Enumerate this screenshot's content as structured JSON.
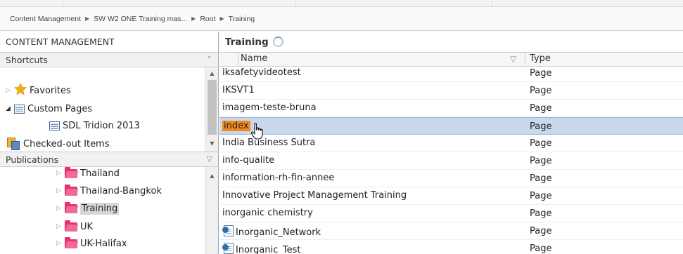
{
  "breadcrumb": {
    "items": [
      "Content Management",
      "SW W2 ONE Training mas...",
      "Root",
      "Training"
    ]
  },
  "left_panel": {
    "title": "CONTENT MANAGEMENT",
    "shortcuts": {
      "header": "Shortcuts",
      "items": [
        {
          "label": "Favorites",
          "icon": "star-icon"
        },
        {
          "label": "Custom Pages",
          "icon": "custom-page-icon"
        },
        {
          "label": "SDL Tridion 2013",
          "icon": "custom-page-icon"
        },
        {
          "label": "Checked-out Items",
          "icon": "checked-out-icon"
        }
      ]
    },
    "publications": {
      "header": "Publications",
      "items": [
        {
          "label": "Thailand",
          "selected": false
        },
        {
          "label": "Thailand-Bangkok",
          "selected": false
        },
        {
          "label": "Training",
          "selected": true
        },
        {
          "label": "UK",
          "selected": false
        },
        {
          "label": "UK-Halifax",
          "selected": false
        }
      ]
    }
  },
  "main": {
    "title": "Training",
    "columns": {
      "name": "Name",
      "type": "Type"
    },
    "rows": [
      {
        "name": "iksafetyvideotest",
        "type": "Page",
        "icon": false,
        "selected": false
      },
      {
        "name": "IKSVT1",
        "type": "Page",
        "icon": false,
        "selected": false
      },
      {
        "name": "imagem-teste-bruna",
        "type": "Page",
        "icon": false,
        "selected": false
      },
      {
        "name": "index",
        "type": "Page",
        "icon": false,
        "selected": true
      },
      {
        "name": "India Business Sutra",
        "type": "Page",
        "icon": false,
        "selected": false
      },
      {
        "name": "info-qualite",
        "type": "Page",
        "icon": false,
        "selected": false
      },
      {
        "name": "information-rh-fin-annee",
        "type": "Page",
        "icon": false,
        "selected": false
      },
      {
        "name": "Innovative Project Management Training",
        "type": "Page",
        "icon": false,
        "selected": false
      },
      {
        "name": "inorganic chemistry",
        "type": "Page",
        "icon": false,
        "selected": false
      },
      {
        "name": "Inorganic_Network",
        "type": "Page",
        "icon": true,
        "selected": false
      },
      {
        "name": "Inorganic_Test",
        "type": "Page",
        "icon": true,
        "selected": false
      }
    ]
  },
  "colors": {
    "selection_row": "#c9d8ec",
    "selection_text_highlight": "#f28a1d",
    "folder": "#e8326f",
    "star": "#f5b301"
  }
}
